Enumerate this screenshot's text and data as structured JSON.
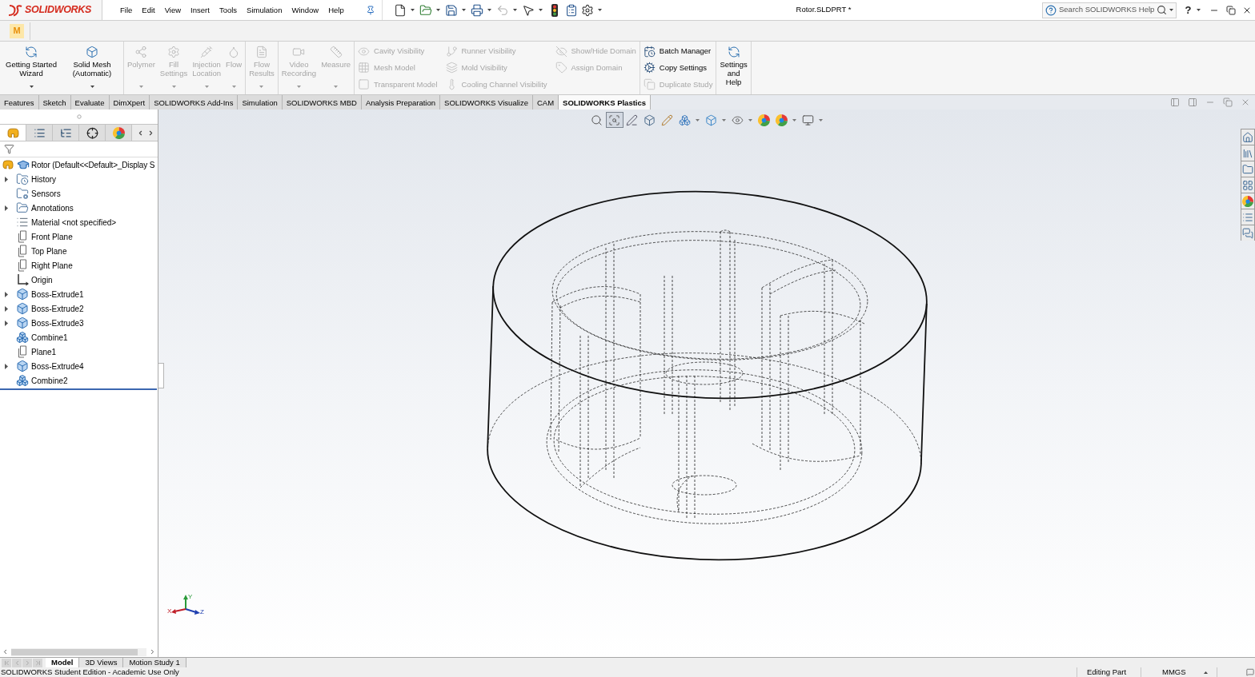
{
  "title_bar": {
    "logo": "SOLIDWORKS",
    "menus": [
      "File",
      "Edit",
      "View",
      "Insert",
      "Tools",
      "Simulation",
      "Window",
      "Help"
    ],
    "document_title": "Rotor.SLDPRT *",
    "search": {
      "placeholder": "Search SOLIDWORKS Help"
    },
    "help": "?"
  },
  "quick_bar": {
    "badge": "M"
  },
  "ribbon": {
    "groups": [
      {
        "kind": "large",
        "items": [
          {
            "label": "Getting Started Wizard",
            "disabled": false,
            "dropdown": true
          },
          {
            "label": "Solid Mesh (Automatic)",
            "disabled": false,
            "dropdown": true
          }
        ]
      },
      {
        "kind": "large",
        "items": [
          {
            "label": "Polymer",
            "disabled": true,
            "dropdown": true
          },
          {
            "label": "Fill Settings",
            "disabled": true,
            "dropdown": true
          },
          {
            "label": "Injection Location",
            "disabled": true,
            "dropdown": true
          },
          {
            "label": "Flow",
            "disabled": true,
            "dropdown": true
          }
        ]
      },
      {
        "kind": "large",
        "items": [
          {
            "label": "Flow Results",
            "disabled": true,
            "dropdown": true
          }
        ]
      },
      {
        "kind": "large",
        "items": [
          {
            "label": "Video Recording",
            "disabled": true,
            "dropdown": true
          },
          {
            "label": "Measure",
            "disabled": true,
            "dropdown": true
          }
        ]
      },
      {
        "kind": "small",
        "items": [
          {
            "label": "Cavity Visibility",
            "disabled": true
          },
          {
            "label": "Mesh Model",
            "disabled": true
          },
          {
            "label": "Transparent Model",
            "disabled": true
          },
          {
            "label": "Runner Visibility",
            "disabled": true
          },
          {
            "label": "Mold Visibility",
            "disabled": true
          },
          {
            "label": "Cooling Channel Visibility",
            "disabled": true
          },
          {
            "label": "Show/Hide Domain",
            "disabled": true
          },
          {
            "label": "Assign Domain",
            "disabled": true
          }
        ]
      },
      {
        "kind": "small",
        "items": [
          {
            "label": "Batch Manager",
            "disabled": false
          },
          {
            "label": "Copy Settings",
            "disabled": false
          },
          {
            "label": "Duplicate Study",
            "disabled": true
          }
        ]
      },
      {
        "kind": "large",
        "items": [
          {
            "label": "Settings and Help",
            "disabled": false,
            "dropdown": false
          }
        ]
      }
    ]
  },
  "command_tabs": [
    {
      "label": "Features",
      "selected": false
    },
    {
      "label": "Sketch",
      "selected": false
    },
    {
      "label": "Evaluate",
      "selected": false
    },
    {
      "label": "DimXpert",
      "selected": false
    },
    {
      "label": "SOLIDWORKS Add-Ins",
      "selected": false
    },
    {
      "label": "Simulation",
      "selected": false
    },
    {
      "label": "SOLIDWORKS MBD",
      "selected": false
    },
    {
      "label": "Analysis Preparation",
      "selected": false
    },
    {
      "label": "SOLIDWORKS Visualize",
      "selected": false
    },
    {
      "label": "CAM",
      "selected": false
    },
    {
      "label": "SOLIDWORKS Plastics",
      "selected": true
    }
  ],
  "feature_manager": {
    "panel_tabs": [
      {
        "selected": true
      },
      {
        "selected": false
      },
      {
        "selected": false
      },
      {
        "selected": false
      },
      {
        "selected": false
      }
    ],
    "tree": {
      "label": "Rotor (Default<<Default>_Display S",
      "children": [
        {
          "label": "History",
          "kind": "history",
          "expandable": true
        },
        {
          "label": "Sensors",
          "kind": "sensors",
          "expandable": false
        },
        {
          "label": "Annotations",
          "kind": "annotations",
          "expandable": true
        },
        {
          "label": "Material <not specified>",
          "kind": "material",
          "expandable": false
        },
        {
          "label": "Front Plane",
          "kind": "plane",
          "expandable": false
        },
        {
          "label": "Top Plane",
          "kind": "plane",
          "expandable": false
        },
        {
          "label": "Right Plane",
          "kind": "plane",
          "expandable": false
        },
        {
          "label": "Origin",
          "kind": "origin",
          "expandable": false
        },
        {
          "label": "Boss-Extrude1",
          "kind": "extrude",
          "expandable": true
        },
        {
          "label": "Boss-Extrude2",
          "kind": "extrude",
          "expandable": true
        },
        {
          "label": "Boss-Extrude3",
          "kind": "extrude",
          "expandable": true
        },
        {
          "label": "Combine1",
          "kind": "combine",
          "expandable": false
        },
        {
          "label": "Plane1",
          "kind": "plane",
          "expandable": false
        },
        {
          "label": "Boss-Extrude4",
          "kind": "extrude",
          "expandable": true
        },
        {
          "label": "Combine2",
          "kind": "combine",
          "expandable": false
        }
      ]
    }
  },
  "heads_up_toolbar": [
    {
      "selected": false,
      "dropdown": false
    },
    {
      "selected": true,
      "dropdown": false
    },
    {
      "selected": false,
      "dropdown": false
    },
    {
      "selected": false,
      "dropdown": false
    },
    {
      "selected": false,
      "dropdown": false
    },
    {
      "selected": false,
      "dropdown": true
    },
    {
      "selected": false,
      "dropdown": true
    },
    {
      "selected": false,
      "dropdown": true
    },
    {
      "selected": false,
      "dropdown": false
    },
    {
      "selected": false,
      "dropdown": true
    },
    {
      "selected": false,
      "dropdown": true
    }
  ],
  "triad": {
    "axes": [
      "X",
      "Y",
      "Z"
    ]
  },
  "model_tabs": [
    {
      "label": "Model",
      "selected": true
    },
    {
      "label": "3D Views",
      "selected": false
    },
    {
      "label": "Motion Study 1",
      "selected": false
    }
  ],
  "status_bar": {
    "edition": "SOLIDWORKS Student Edition - Academic Use Only",
    "mode": "Editing Part",
    "units": "MMGS"
  }
}
